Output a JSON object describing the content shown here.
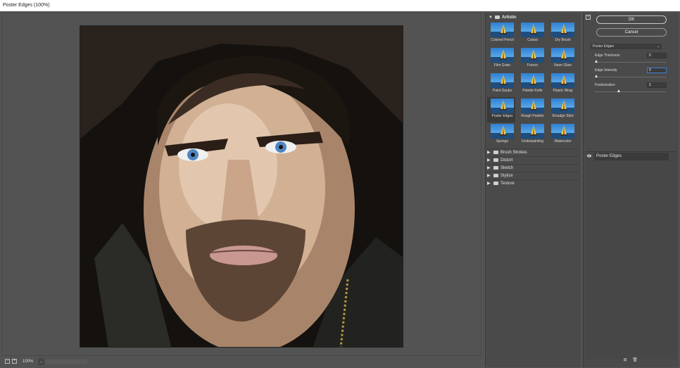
{
  "window": {
    "title": "Poster Edges (100%)"
  },
  "canvas": {
    "zoom_label": "100%",
    "minus": "−",
    "plus": "+",
    "dropdown": "⌄"
  },
  "gallery": {
    "category_open": "Artistic",
    "filters": [
      {
        "label": "Colored Pencil",
        "selected": false
      },
      {
        "label": "Cutout",
        "selected": false
      },
      {
        "label": "Dry Brush",
        "selected": false
      },
      {
        "label": "Film Grain",
        "selected": false
      },
      {
        "label": "Fresco",
        "selected": false
      },
      {
        "label": "Neon Glow",
        "selected": false
      },
      {
        "label": "Paint Daubs",
        "selected": false
      },
      {
        "label": "Palette Knife",
        "selected": false
      },
      {
        "label": "Plastic Wrap",
        "selected": false
      },
      {
        "label": "Poster Edges",
        "selected": true
      },
      {
        "label": "Rough Pastels",
        "selected": false
      },
      {
        "label": "Smudge Stick",
        "selected": false
      },
      {
        "label": "Sponge",
        "selected": false
      },
      {
        "label": "Underpainting",
        "selected": false
      },
      {
        "label": "Watercolor",
        "selected": false
      }
    ],
    "categories": [
      "Brush Strokes",
      "Distort",
      "Sketch",
      "Stylize",
      "Texture"
    ]
  },
  "settings": {
    "ok_label": "OK",
    "cancel_label": "Cancel",
    "filter_select": "Poster Edges",
    "params": [
      {
        "label": "Edge Thickness",
        "value": "0",
        "level": 0.0
      },
      {
        "label": "Edge Intensity",
        "value": "0",
        "level": 0.0
      },
      {
        "label": "Posterization",
        "value": "2",
        "level": 0.33
      }
    ],
    "layer_name": "Poster Edges"
  },
  "colors": {
    "panel": "#4a4a4a",
    "accent": "#3e7fd0",
    "background": "#535353"
  }
}
